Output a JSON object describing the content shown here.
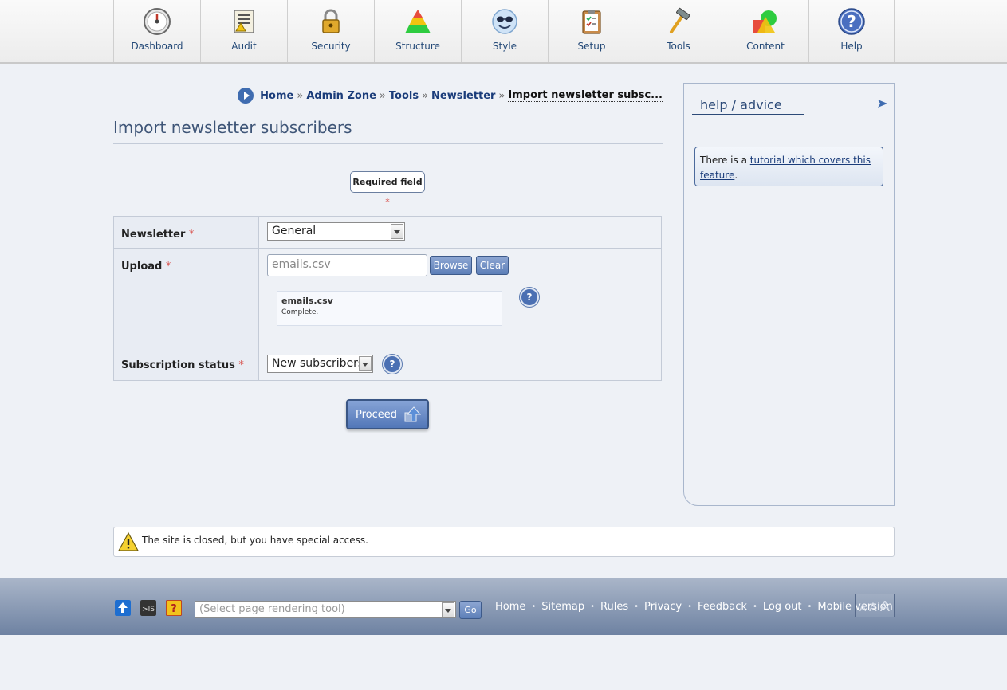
{
  "nav": {
    "items": [
      {
        "label": "Dashboard",
        "icon": "gauge-icon"
      },
      {
        "label": "Audit",
        "icon": "audit-document-icon"
      },
      {
        "label": "Security",
        "icon": "padlock-icon"
      },
      {
        "label": "Structure",
        "icon": "pyramid-icon"
      },
      {
        "label": "Style",
        "icon": "smiley-sunglasses-icon"
      },
      {
        "label": "Setup",
        "icon": "clipboard-checklist-icon"
      },
      {
        "label": "Tools",
        "icon": "hammer-icon"
      },
      {
        "label": "Content",
        "icon": "shapes-icon"
      },
      {
        "label": "Help",
        "icon": "question-mark-icon"
      }
    ]
  },
  "breadcrumb": {
    "home": "Home",
    "admin_zone": "Admin Zone",
    "tools": "Tools",
    "newsletter": "Newsletter",
    "separator": "»",
    "current": "Import newsletter subsc..."
  },
  "page": {
    "title": "Import newsletter subscribers",
    "required_label": "Required field",
    "required_star": "*"
  },
  "form": {
    "newsletter": {
      "label": "Newsletter",
      "value": "General"
    },
    "upload": {
      "label": "Upload",
      "value": "emails.csv",
      "browse_label": "Browse",
      "clear_label": "Clear",
      "file_name": "emails.csv",
      "file_status": "Complete."
    },
    "subscription_status": {
      "label": "Subscription status",
      "value": "New subscribers"
    },
    "help_glyph": "?",
    "proceed_label": "Proceed"
  },
  "help_panel": {
    "title": "help / advice",
    "note_prefix": "There is a ",
    "note_link": "tutorial which covers this feature",
    "note_suffix": "."
  },
  "notice": {
    "text": "The site is closed, but you have special access."
  },
  "footer": {
    "render_tool_placeholder": "(Select page rendering tool)",
    "go_label": "Go",
    "links": [
      "Home",
      "Sitemap",
      "Rules",
      "Privacy",
      "Feedback",
      "Log out",
      "Mobile version"
    ],
    "link_separator": "•",
    "text_size": [
      "A",
      "A",
      "A"
    ]
  },
  "colors": {
    "accent": "#4b70b3",
    "link": "#1a3c7a",
    "footer": "#6e82a2",
    "required": "#d9534f"
  }
}
